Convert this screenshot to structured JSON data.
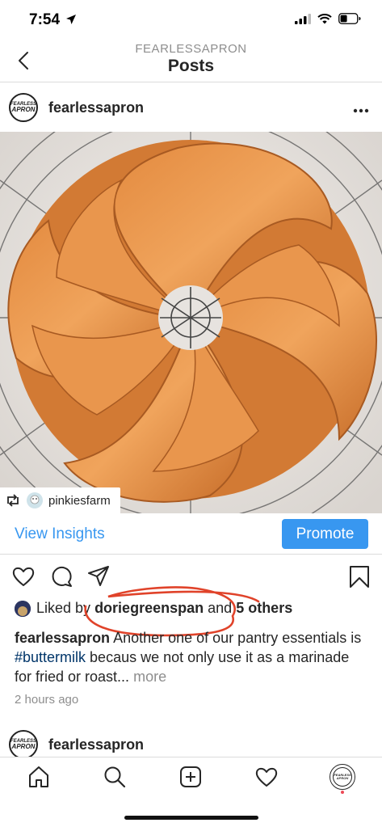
{
  "status_bar": {
    "time": "7:54",
    "battery_icon": "battery-icon",
    "wifi_icon": "wifi-icon",
    "signal_icon": "signal-icon"
  },
  "header": {
    "subtitle": "FEARLESSAPRON",
    "title": "Posts"
  },
  "post": {
    "username": "fearlessapron",
    "avatar_text": [
      "FEARLESS",
      "APRON"
    ],
    "image_alt": "bundt cake on wire cooling rack",
    "repost": {
      "username": "pinkiesfarm"
    },
    "insights_label": "View Insights",
    "promote_label": "Promote",
    "likes": {
      "prefix": "Liked by",
      "first_liker": "doriegreenspan",
      "conjunction": "and",
      "others": "5 others"
    },
    "caption": {
      "author": "fearlessapron",
      "text_before": "Another one of our pantry essentials is",
      "hashtag": "#buttermilk",
      "text_after": "becaus we not only use it as a marinade for fried or roast...",
      "more": "more"
    },
    "timestamp": "2 hours ago"
  },
  "next_post": {
    "username": "fearlessapron"
  },
  "colors": {
    "accent": "#3897f0",
    "annotation": "#e0432a",
    "hashtag": "#003569"
  },
  "tab_bar": [
    "home-icon",
    "search-icon",
    "add-post-icon",
    "activity-heart-icon",
    "profile-icon"
  ]
}
